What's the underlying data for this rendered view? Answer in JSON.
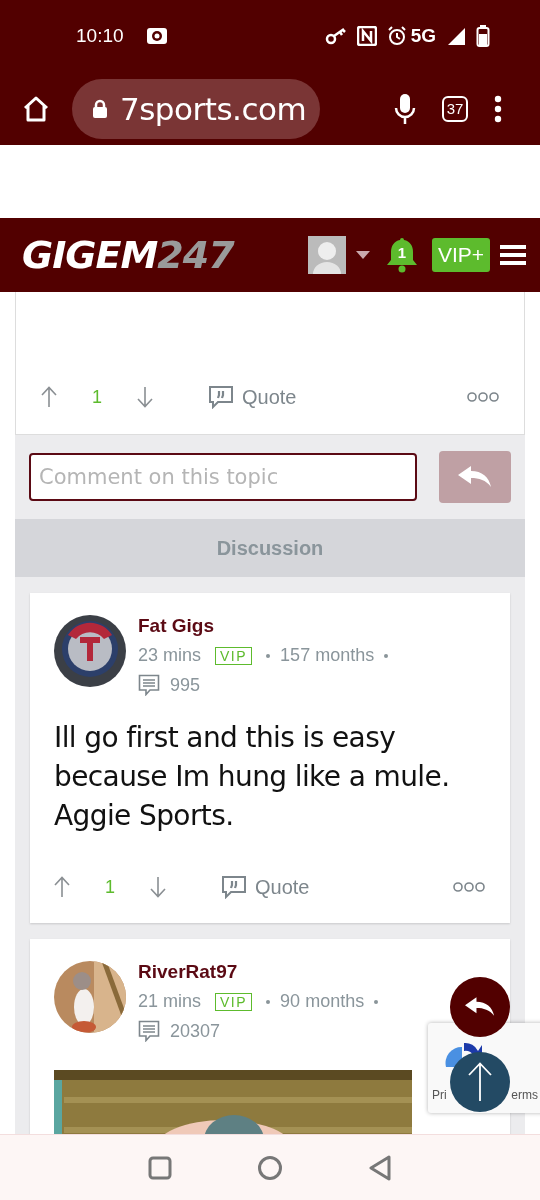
{
  "status_bar": {
    "time": "10:10",
    "network": "5G"
  },
  "browser": {
    "url": "7sports.com",
    "tab_count": "37"
  },
  "site_header": {
    "logo_main": "GIGEM",
    "logo_accent": "247",
    "notifications": "1",
    "vip_button": "VIP+"
  },
  "previous_post": {
    "votes": "1",
    "quote": "Quote"
  },
  "comment": {
    "placeholder": "Comment on this topic"
  },
  "section_title": "Discussion",
  "posts": [
    {
      "author": "Fat Gigs",
      "time": "23 mins",
      "badge": "VIP",
      "tenure": "157 months",
      "comments": "995",
      "body": "Ill go first and this is easy because Im hung like a mule. Aggie Sports.",
      "votes": "1",
      "quote": "Quote"
    },
    {
      "author": "RiverRat97",
      "time": "21 mins",
      "badge": "VIP",
      "tenure": "90 months",
      "comments": "20307"
    }
  ],
  "recaptcha": {
    "text_left": "Pri",
    "text_right": "erms"
  }
}
